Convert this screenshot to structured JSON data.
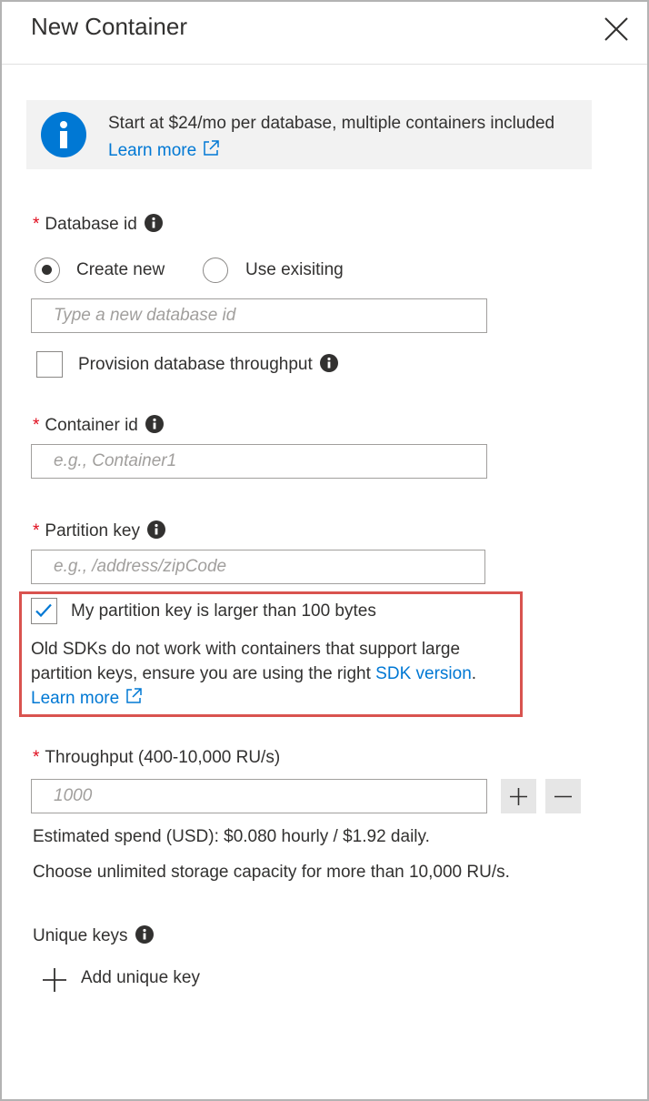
{
  "header": {
    "title": "New Container"
  },
  "banner": {
    "text": "Start at $24/mo per database, multiple containers included",
    "link": "Learn more"
  },
  "database": {
    "label": "Database id",
    "options": [
      {
        "label": "Create new",
        "selected": true
      },
      {
        "label": "Use exisiting",
        "selected": false
      }
    ],
    "placeholder": "Type a new database id",
    "provision_label": "Provision database throughput",
    "provision_checked": false
  },
  "container": {
    "label": "Container id",
    "placeholder": "e.g., Container1"
  },
  "partition": {
    "label": "Partition key",
    "placeholder": "e.g., /address/zipCode",
    "large_key_label": "My partition key is larger than 100 bytes",
    "large_key_checked": true,
    "warning_text": "Old SDKs do not work with containers that support large partition keys, ensure you are using the right",
    "sdk_link": "SDK version",
    "period": ".",
    "learn_more": "Learn more"
  },
  "throughput": {
    "label": "Throughput (400-10,000 RU/s)",
    "placeholder": "1000",
    "estimate": "Estimated spend (USD): $0.080 hourly / $1.92 daily.",
    "note": "Choose unlimited storage capacity for more than 10,000 RU/s."
  },
  "unique_keys": {
    "label": "Unique keys",
    "add_label": "Add unique key"
  },
  "colors": {
    "accent": "#0078d4",
    "required": "#e00b1c",
    "highlight_border": "#d9534f"
  },
  "icons": {
    "close": "close-icon",
    "info": "info-icon",
    "external": "external-link-icon",
    "check": "checkmark-icon",
    "plus": "plus-icon",
    "minus": "minus-icon"
  }
}
